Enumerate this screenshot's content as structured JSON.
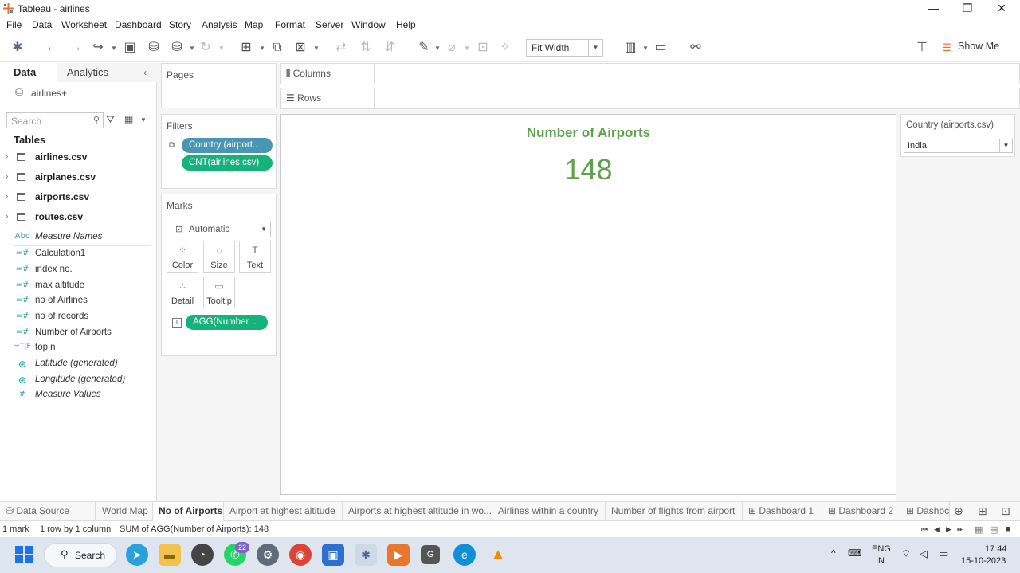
{
  "window": {
    "title": "Tableau - airlines",
    "minimize": "—",
    "restore": "❐",
    "close": "✕"
  },
  "menu": [
    "File",
    "Data",
    "Worksheet",
    "Dashboard",
    "Story",
    "Analysis",
    "Map",
    "Format",
    "Server",
    "Window",
    "Help"
  ],
  "toolbar": {
    "fit": "Fit Width",
    "show_me": "Show Me"
  },
  "data_pane": {
    "tab_data": "Data",
    "tab_analytics": "Analytics",
    "datasource": "airlines+",
    "search_placeholder": "Search",
    "tables_heading": "Tables",
    "tables": [
      "airlines.csv",
      "airplanes.csv",
      "airports.csv",
      "routes.csv"
    ],
    "fields": [
      {
        "icon": "Abc",
        "label": "Measure Names",
        "italic": true
      },
      {
        "icon": "=#",
        "label": "Calculation1",
        "italic": false
      },
      {
        "icon": "=#",
        "label": "index no.",
        "italic": false
      },
      {
        "icon": "=#",
        "label": "max altitude",
        "italic": false
      },
      {
        "icon": "=#",
        "label": "no of Airlines",
        "italic": false
      },
      {
        "icon": "=#",
        "label": "no of records",
        "italic": false
      },
      {
        "icon": "=#",
        "label": "Number of Airports",
        "italic": false
      },
      {
        "icon": "=T|F",
        "label": "top n",
        "italic": false
      },
      {
        "icon": "⊕",
        "label": "Latitude (generated)",
        "italic": true
      },
      {
        "icon": "⊕",
        "label": "Longitude (generated)",
        "italic": true
      },
      {
        "icon": "#",
        "label": "Measure Values",
        "italic": true
      }
    ]
  },
  "cards": {
    "pages": "Pages",
    "filters": "Filters",
    "filter_pills": [
      "Country (airport..",
      "CNT(airlines.csv)"
    ],
    "marks": "Marks",
    "mark_type": "Automatic",
    "mark_buttons": [
      {
        "glyph": "⁘",
        "label": "Color"
      },
      {
        "glyph": "◌",
        "label": "Size"
      },
      {
        "glyph": "T",
        "label": "Text"
      },
      {
        "glyph": "∴",
        "label": "Detail"
      },
      {
        "glyph": "▭",
        "label": "Tooltip"
      }
    ],
    "mark_pill": "AGG(Number .."
  },
  "shelves": {
    "columns": "Columns",
    "rows": "Rows"
  },
  "view": {
    "title": "Number of Airports",
    "value": "148"
  },
  "quick_filter": {
    "title": "Country (airports.csv)",
    "value": "India"
  },
  "sheet_tabs": [
    {
      "label": "Data Source",
      "active": false
    },
    {
      "label": "World Map",
      "active": false
    },
    {
      "label": "No of Airports",
      "active": true
    },
    {
      "label": "Airport at highest altitude",
      "active": false
    },
    {
      "label": "Airports at highest altitude in wo...",
      "active": false
    },
    {
      "label": "Airlines within a country",
      "active": false
    },
    {
      "label": "Number of flights from airport",
      "active": false
    },
    {
      "label": "Dashboard 1",
      "active": false
    },
    {
      "label": "Dashboard 2",
      "active": false
    },
    {
      "label": "Dashbc",
      "active": false
    }
  ],
  "status": {
    "marks": "1 mark",
    "dims": "1 row by 1 column",
    "sum": "SUM of AGG(Number of Airports): 148"
  },
  "taskbar": {
    "search": "Search",
    "whatsapp_badge": "22",
    "lang": "ENG",
    "region": "IN",
    "time": "17:44",
    "date": "15-10-2023"
  },
  "colors": {
    "accent_green": "#5fa14e",
    "pill_blue": "#4996b2",
    "pill_green": "#15b27a"
  }
}
